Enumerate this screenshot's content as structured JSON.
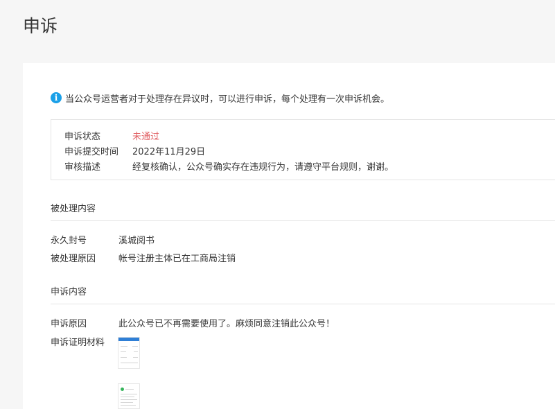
{
  "page": {
    "title": "申诉"
  },
  "notice": {
    "icon": "info-icon",
    "text": "当公众号运营者对于处理存在异议时，可以进行申诉，每个处理有一次申诉机会。"
  },
  "status": {
    "state_label": "申诉状态",
    "state_value": "未通过",
    "state_color": "#e15f63",
    "submit_label": "申诉提交时间",
    "submit_value": "2022年11月29日",
    "review_label": "审核描述",
    "review_value": "经复核确认，公众号确实存在违规行为，请遵守平台规则，谢谢。"
  },
  "processed": {
    "section_title": "被处理内容",
    "ban_label": "永久封号",
    "ban_value": "溪城阅书",
    "reason_label": "被处理原因",
    "reason_value": "帐号注册主体已在工商局注销"
  },
  "appeal": {
    "section_title": "申诉内容",
    "reason_label": "申诉原因",
    "reason_value": "此公众号已不再需要使用了。麻烦同意注销此公众号！",
    "evidence_label": "申诉证明材料"
  },
  "colors": {
    "accent": "#1aa0e8",
    "fail": "#e15f63"
  }
}
